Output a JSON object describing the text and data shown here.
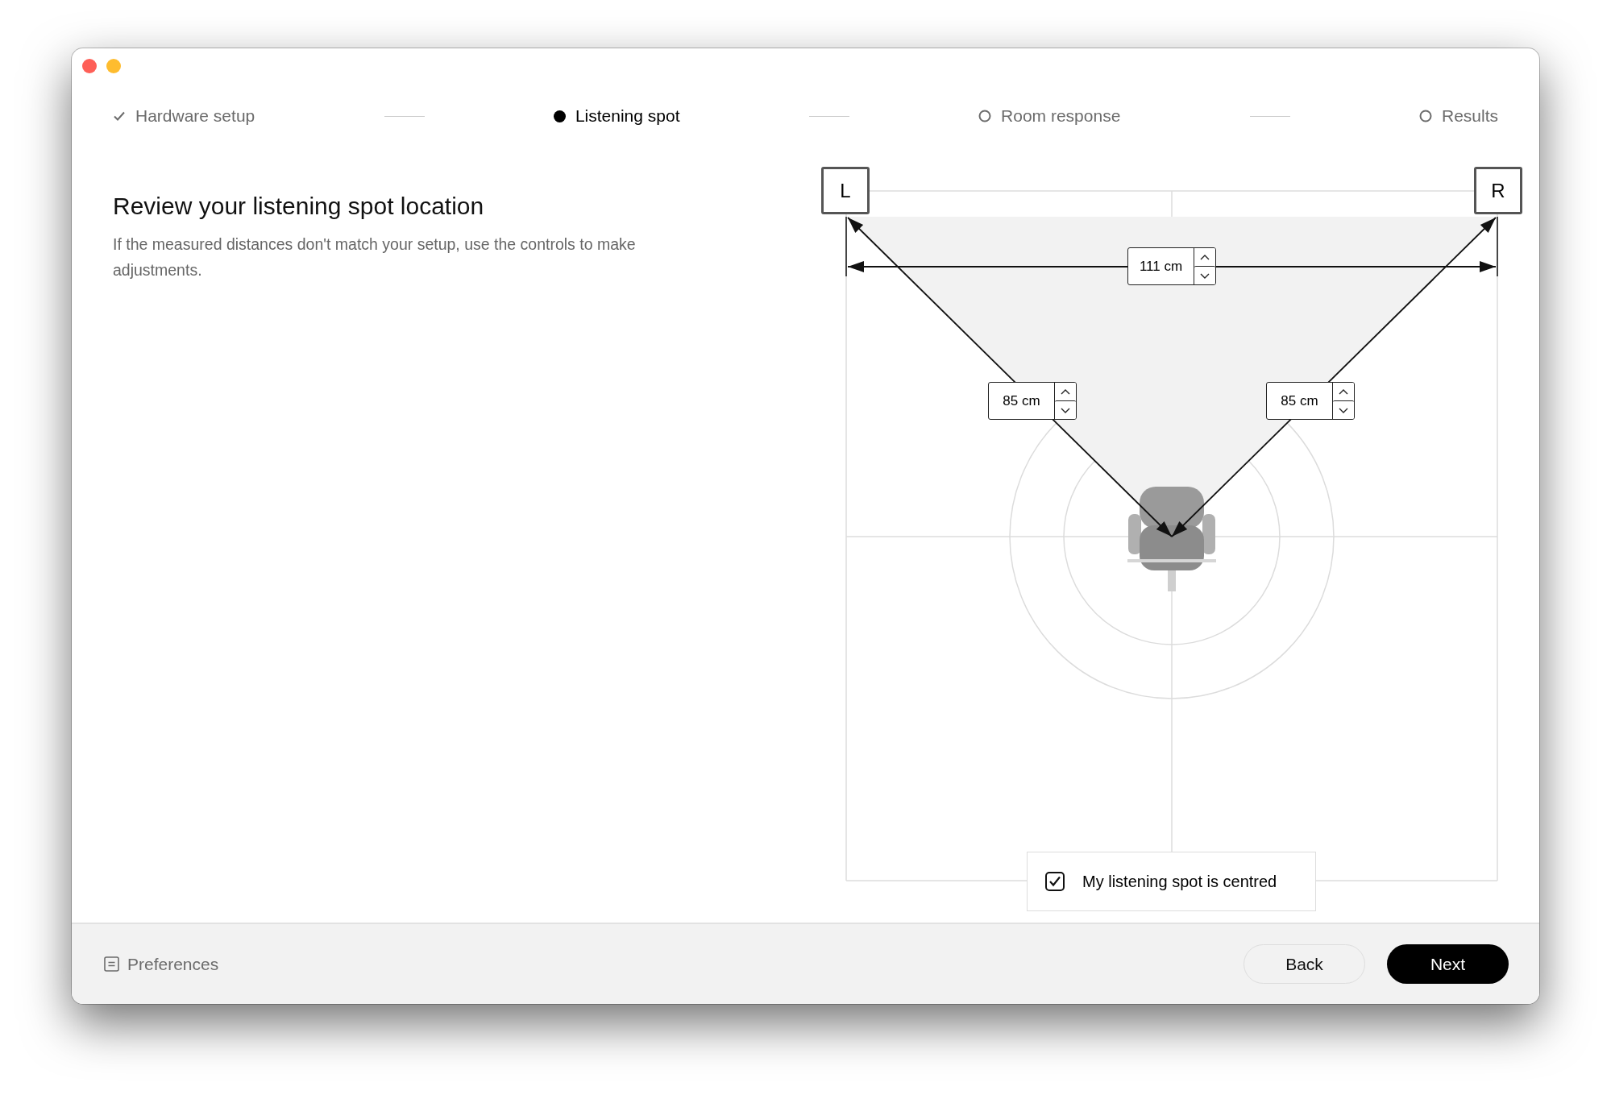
{
  "window_controls": [
    {
      "color": "#fe5f57"
    },
    {
      "color": "#febc2e"
    }
  ],
  "steps": [
    {
      "label": "Hardware setup",
      "kind": "done"
    },
    {
      "label": "Listening spot",
      "kind": "current"
    },
    {
      "label": "Room response",
      "kind": "pending"
    },
    {
      "label": "Results",
      "kind": "pending"
    }
  ],
  "heading": "Review your listening spot location",
  "description": "If the measured distances don't match your setup, use the controls to make adjustments.",
  "diagram": {
    "left_speaker": "L",
    "right_speaker": "R",
    "speaker_distance": {
      "value": "111 cm"
    },
    "left_distance": {
      "value": "85 cm"
    },
    "right_distance": {
      "value": "85 cm"
    },
    "centred_checkbox": {
      "label": "My listening spot is centred",
      "checked": true
    }
  },
  "footer": {
    "preferences": "Preferences",
    "buttons": [
      {
        "label": "Back",
        "kind": "secondary"
      },
      {
        "label": "Next",
        "kind": "primary"
      }
    ]
  }
}
